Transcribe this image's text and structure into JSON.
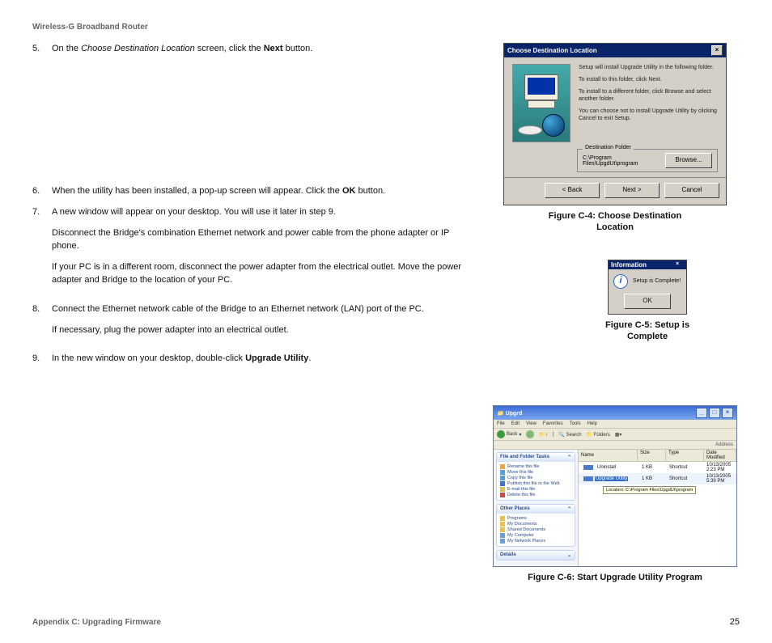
{
  "header": "Wireless-G Broadband Router",
  "steps": {
    "s5": {
      "num": "5.",
      "pre": "On the ",
      "em": "Choose Destination Location",
      "mid": " screen, click the ",
      "btn": "Next",
      "post": " button."
    },
    "s6": {
      "num": "6.",
      "pre": "When the utility has been installed, a pop-up screen will appear. Click the ",
      "btn": "OK",
      "post": " button."
    },
    "s7": {
      "num": "7.",
      "line": "A new window will appear on your desktop. You will use it later in step 9.",
      "p1": "Disconnect the Bridge's combination Ethernet network and power cable from the phone adapter or IP phone.",
      "p2": "If your PC is in a different room, disconnect the power adapter from the electrical outlet. Move the power adapter and Bridge to the location of your PC."
    },
    "s8": {
      "num": "8.",
      "line": "Connect the Ethernet network cable of the Bridge to an Ethernet network (LAN) port of the PC.",
      "p1": "If necessary, plug the power adapter into an electrical outlet."
    },
    "s9": {
      "num": "9.",
      "pre": "In the new window on your desktop, double-click ",
      "btn": "Upgrade Utility",
      "post": "."
    }
  },
  "figC4": {
    "caption": "Figure C-4: Choose Destination Location",
    "title": "Choose Destination Location",
    "t1": "Setup will install Upgrade Utility in the following folder.",
    "t2": "To install to this folder, click Next.",
    "t3": "To install to a different folder, click Browse and select another folder.",
    "t4": "You can choose not to install Upgrade Utility by clicking Cancel to exit Setup.",
    "destLegend": "Destination Folder",
    "destPath": "C:\\Program Files\\UpgdUt\\program",
    "browse": "Browse...",
    "back": "< Back",
    "next": "Next >",
    "cancel": "Cancel"
  },
  "figC5": {
    "caption": "Figure C-5: Setup is Complete",
    "title": "Information",
    "msg": "Setup is Complete!",
    "ok": "OK"
  },
  "figC6": {
    "caption": "Figure C-6: Start Upgrade Utility Program",
    "title": "Upgrd",
    "menu": {
      "file": "File",
      "edit": "Edit",
      "view": "View",
      "fav": "Favorites",
      "tools": "Tools",
      "help": "Help"
    },
    "tb": {
      "back": "Back",
      "search": "Search",
      "folders": "Folders"
    },
    "addr": "Address",
    "panel1": {
      "head": "File and Folder Tasks",
      "i1": "Rename this file",
      "i2": "Move this file",
      "i3": "Copy this file",
      "i4": "Publish this file to the Web",
      "i5": "E-mail this file",
      "i6": "Delete this file"
    },
    "panel2": {
      "head": "Other Places",
      "i1": "Programs",
      "i2": "My Documents",
      "i3": "Shared Documents",
      "i4": "My Computer",
      "i5": "My Network Places"
    },
    "panel3": {
      "head": "Details"
    },
    "cols": {
      "name": "Name",
      "size": "Size",
      "type": "Type",
      "date": "Date Modified"
    },
    "rows": [
      {
        "name": "Uninstall",
        "size": "1 KB",
        "type": "Shortcut",
        "date": "10/13/2005 2:23 PM"
      },
      {
        "name": "Upgrade Utility",
        "size": "1 KB",
        "type": "Shortcut",
        "date": "10/13/2005 5:39 PM"
      }
    ],
    "tooltip": "Location: C:\\Program Files\\UpgdUt\\program"
  },
  "footer": {
    "left": "Appendix C: Upgrading Firmware",
    "page": "25"
  }
}
